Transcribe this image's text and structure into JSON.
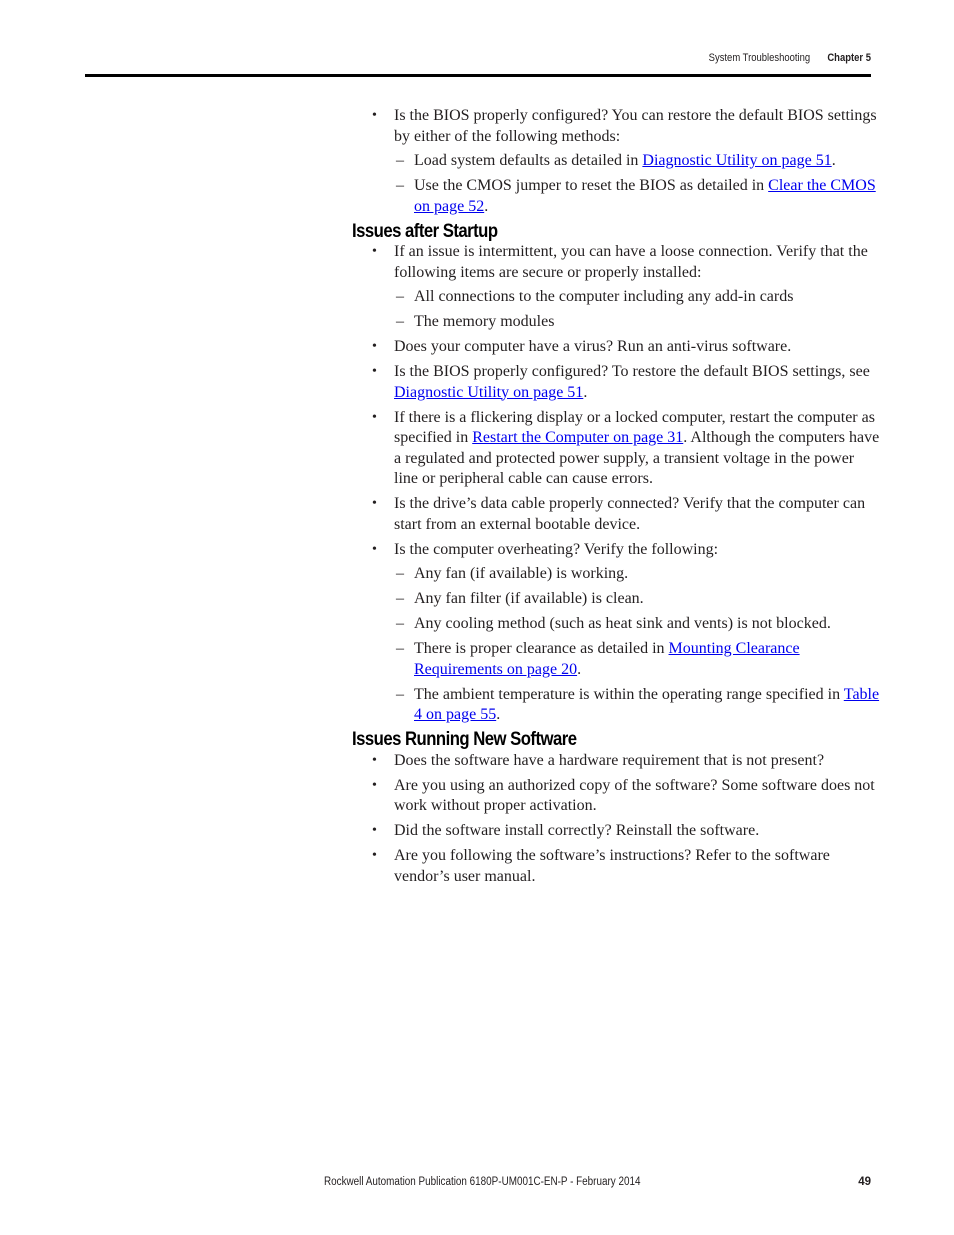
{
  "header": {
    "section_title": "System Troubleshooting",
    "chapter_label": "Chapter 5"
  },
  "intro_list": {
    "item": {
      "text": "Is the BIOS properly configured? You can restore the default BIOS settings by either of the following methods:",
      "subitems": [
        {
          "before": "Load system defaults as detailed in ",
          "link": "Diagnostic Utility on page 51",
          "after": "."
        },
        {
          "before": "Use the CMOS jumper to reset the BIOS as detailed in ",
          "link": "Clear the CMOS on page 52",
          "after": "."
        }
      ]
    }
  },
  "issues_after_startup": {
    "heading": "Issues after Startup",
    "items": [
      {
        "text": "If an issue is intermittent, you can have a loose connection. Verify that the following items are secure or properly installed:",
        "subitems": [
          "All connections to the computer including any add-in cards",
          "The memory modules"
        ]
      },
      {
        "text": "Does your computer have a virus? Run an anti-virus software."
      },
      {
        "before": "Is the BIOS properly configured? To restore the default BIOS settings, see ",
        "link": "Diagnostic Utility on page 51",
        "after": "."
      },
      {
        "before": "If there is a flickering display or a locked computer, restart the computer as specified in ",
        "link": "Restart the Computer on page 31",
        "after": ". Although the computers have a regulated and protected power supply, a transient voltage in the power line or peripheral cable can cause errors."
      },
      {
        "text": "Is the drive’s data cable properly connected? Verify that the computer can start from an external bootable device."
      },
      {
        "text": "Is the computer overheating? Verify the following:",
        "subitems": [
          {
            "text": "Any fan (if available) is working."
          },
          {
            "text": "Any fan filter (if available) is clean."
          },
          {
            "text": "Any cooling method (such as heat sink and vents) is not blocked."
          },
          {
            "before": "There is proper clearance as detailed in ",
            "link": "Mounting Clearance Requirements on page 20",
            "after": "."
          },
          {
            "before": "The ambient temperature is within the operating range specified in ",
            "link": "Table 4 on page 55",
            "after": "."
          }
        ]
      }
    ]
  },
  "issues_running_new_software": {
    "heading": "Issues Running New Software",
    "items": [
      "Does the software have a hardware requirement that is not present?",
      "Are you using an authorized copy of the software? Some software does not work without proper activation.",
      "Did the software install correctly? Reinstall the software.",
      "Are you following the software’s instructions? Refer to the software vendor’s user manual."
    ]
  },
  "footer": {
    "publication": "Rockwell Automation Publication 6180P-UM001C-EN-P - February 2014",
    "page_number": "49"
  },
  "colors": {
    "link": "#0000ee",
    "text": "#231f20",
    "rule": "#000000"
  }
}
